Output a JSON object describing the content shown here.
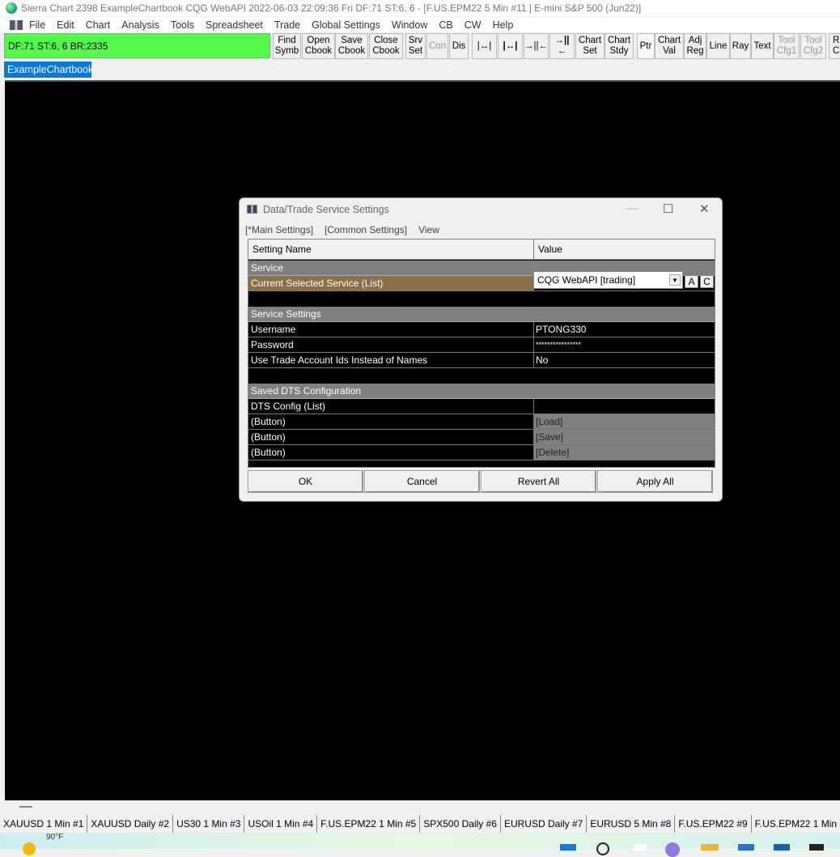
{
  "window": {
    "title": "Sierra Chart 2398 ExampleChartbook  CQG WebAPI 2022-06-03  22:09:36 Fri  DF:71  ST:6, 6 - [F.US.EPM22  5 Min   #11 | E-mini S&P 500 (Jun22)]"
  },
  "menu": [
    "File",
    "Edit",
    "Chart",
    "Analysis",
    "Tools",
    "Spreadsheet",
    "Trade",
    "Global Settings",
    "Window",
    "CB",
    "CW",
    "Help"
  ],
  "status": "DF:71  ST:6, 6  BR:2335",
  "toolbar": {
    "find": [
      "Find",
      "Symb"
    ],
    "open": [
      "Open",
      "Cbook"
    ],
    "save": [
      "Save",
      "Cbook"
    ],
    "close": [
      "Close",
      "Cbook"
    ],
    "srv": [
      "Srv",
      "Set"
    ],
    "con": "Con",
    "dis": "Dis",
    "chartset": [
      "Chart",
      "Set"
    ],
    "chartstdy": [
      "Chart",
      "Stdy"
    ],
    "ptr": "Ptr",
    "chartval": [
      "Chart",
      "Val"
    ],
    "adjreg": [
      "Adj",
      "Reg"
    ],
    "line": "Line",
    "ray": "Ray",
    "text": "Text",
    "cfg1": [
      "Tool",
      "Cfg1"
    ],
    "cfg2": [
      "Tool",
      "Cfg2"
    ],
    "rp": [
      "Rp",
      "C"
    ],
    "icons": [
      "|↔|",
      "|↔|",
      "→||←",
      "→||←"
    ]
  },
  "chartbook_tab": "ExampleChartbook",
  "chart_tabs": [
    "XAUUSD  1 Min   #1",
    "XAUUSD  Daily  #2",
    "US30  1 Min   #3",
    "USOil  1 Min   #4",
    "F.US.EPM22  1 Min   #5",
    "SPX500  Daily  #6",
    "EURUSD  Daily  #7",
    "EURUSD  5 Min   #8",
    "F.US.EPM22  #9",
    "F.US.EPM22  1 Min"
  ],
  "taskbar": {
    "weather": "90°F"
  },
  "dialog": {
    "title": "Data/Trade Service Settings",
    "menu": [
      "[*Main Settings]",
      "[Common Settings]",
      "View"
    ],
    "headers": {
      "name": "Setting Name",
      "value": "Value"
    },
    "service_section": "Service",
    "current_service": {
      "name": "Current Selected Service (List)",
      "value": "CQG WebAPI    [trading]",
      "a": "A",
      "c": "C"
    },
    "service_settings_section": "Service Settings",
    "rows": [
      {
        "name": "Username",
        "value": "PTONG330"
      },
      {
        "name": "Password",
        "value": "****************"
      },
      {
        "name": "Use Trade Account Ids Instead of Names",
        "value": "No"
      }
    ],
    "saved_section": "Saved DTS Configuration",
    "dts_config": {
      "name": "DTS Config (List)",
      "value": ""
    },
    "buttons_rows": [
      {
        "name": " (Button)",
        "value": "[Load]"
      },
      {
        "name": " (Button)",
        "value": "[Save]"
      },
      {
        "name": " (Button)",
        "value": "[Delete]"
      }
    ],
    "footer": {
      "ok": "OK",
      "cancel": "Cancel",
      "revert": "Revert All",
      "apply": "Apply All"
    }
  }
}
